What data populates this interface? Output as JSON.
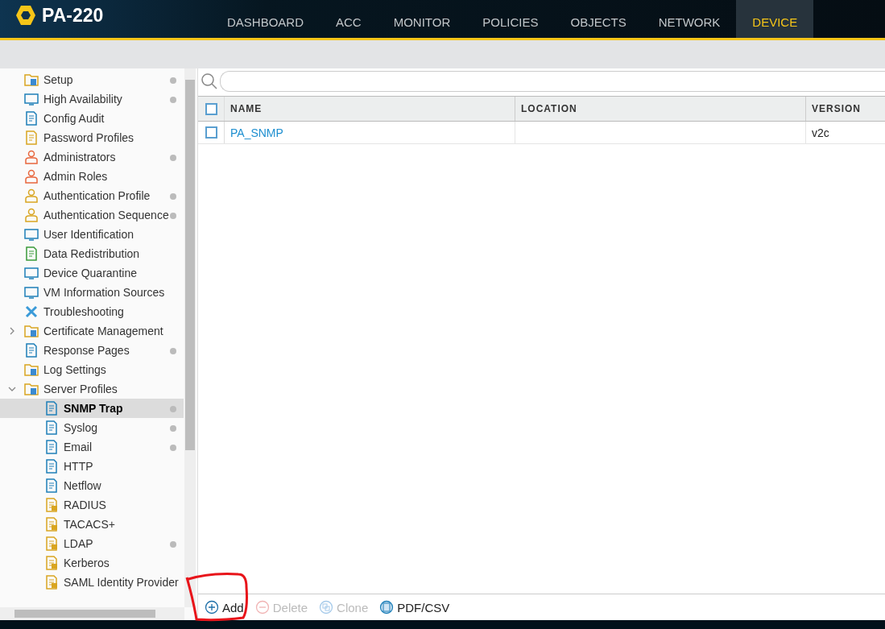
{
  "header": {
    "logo": "PA-220",
    "tabs": [
      {
        "label": "DASHBOARD",
        "selected": false
      },
      {
        "label": "ACC",
        "selected": false
      },
      {
        "label": "MONITOR",
        "selected": false
      },
      {
        "label": "POLICIES",
        "selected": false
      },
      {
        "label": "OBJECTS",
        "selected": false
      },
      {
        "label": "NETWORK",
        "selected": false
      },
      {
        "label": "DEVICE",
        "selected": true
      }
    ]
  },
  "sidebar": {
    "items": [
      {
        "label": "Setup",
        "kind": "folder",
        "dot": true,
        "selected": false
      },
      {
        "label": "High Availability",
        "kind": "device",
        "dot": true,
        "selected": false
      },
      {
        "label": "Config Audit",
        "kind": "doc",
        "dot": false,
        "selected": false
      },
      {
        "label": "Password Profiles",
        "kind": "key",
        "dot": false,
        "selected": false
      },
      {
        "label": "Administrators",
        "kind": "person",
        "dot": true,
        "selected": false
      },
      {
        "label": "Admin Roles",
        "kind": "person",
        "dot": false,
        "selected": false
      },
      {
        "label": "Authentication Profile",
        "kind": "lockperson",
        "dot": true,
        "selected": false
      },
      {
        "label": "Authentication Sequence",
        "kind": "lockperson",
        "dot": true,
        "selected": false
      },
      {
        "label": "User Identification",
        "kind": "card",
        "dot": false,
        "selected": false
      },
      {
        "label": "Data Redistribution",
        "kind": "tree",
        "dot": false,
        "selected": false
      },
      {
        "label": "Device Quarantine",
        "kind": "monitor",
        "dot": false,
        "selected": false
      },
      {
        "label": "VM Information Sources",
        "kind": "monitor",
        "dot": false,
        "selected": false
      },
      {
        "label": "Troubleshooting",
        "kind": "tool",
        "dot": false,
        "selected": false
      },
      {
        "label": "Certificate Management",
        "kind": "folder",
        "dot": false,
        "selected": false,
        "expanded": false
      },
      {
        "label": "Response Pages",
        "kind": "doc",
        "dot": true,
        "selected": false
      },
      {
        "label": "Log Settings",
        "kind": "folder",
        "dot": false,
        "selected": false
      },
      {
        "label": "Server Profiles",
        "kind": "folder",
        "dot": false,
        "selected": false,
        "expanded": true,
        "children": [
          {
            "label": "SNMP Trap",
            "kind": "server",
            "dot": true,
            "selected": true
          },
          {
            "label": "Syslog",
            "kind": "server",
            "dot": true,
            "selected": false
          },
          {
            "label": "Email",
            "kind": "server",
            "dot": true,
            "selected": false
          },
          {
            "label": "HTTP",
            "kind": "server",
            "dot": false,
            "selected": false
          },
          {
            "label": "Netflow",
            "kind": "server",
            "dot": false,
            "selected": false
          },
          {
            "label": "RADIUS",
            "kind": "lockserver",
            "dot": false,
            "selected": false
          },
          {
            "label": "TACACS+",
            "kind": "lockserver",
            "dot": false,
            "selected": false
          },
          {
            "label": "LDAP",
            "kind": "lockserver",
            "dot": true,
            "selected": false
          },
          {
            "label": "Kerberos",
            "kind": "lockserver",
            "dot": false,
            "selected": false
          },
          {
            "label": "SAML Identity Provider",
            "kind": "lockserver",
            "dot": false,
            "selected": false
          }
        ]
      }
    ]
  },
  "table": {
    "columns": [
      "NAME",
      "LOCATION",
      "VERSION"
    ],
    "header_checked": false,
    "rows": [
      {
        "cells": [
          "PA_SNMP",
          "",
          "v2c"
        ],
        "checked": false
      }
    ]
  },
  "toolbar": [
    {
      "label": "Add",
      "kind": "add",
      "disabled": false
    },
    {
      "label": "Delete",
      "kind": "delete",
      "disabled": true
    },
    {
      "label": "Clone",
      "kind": "clone",
      "disabled": true
    },
    {
      "label": "PDF/CSV",
      "kind": "pdf",
      "disabled": false
    }
  ]
}
